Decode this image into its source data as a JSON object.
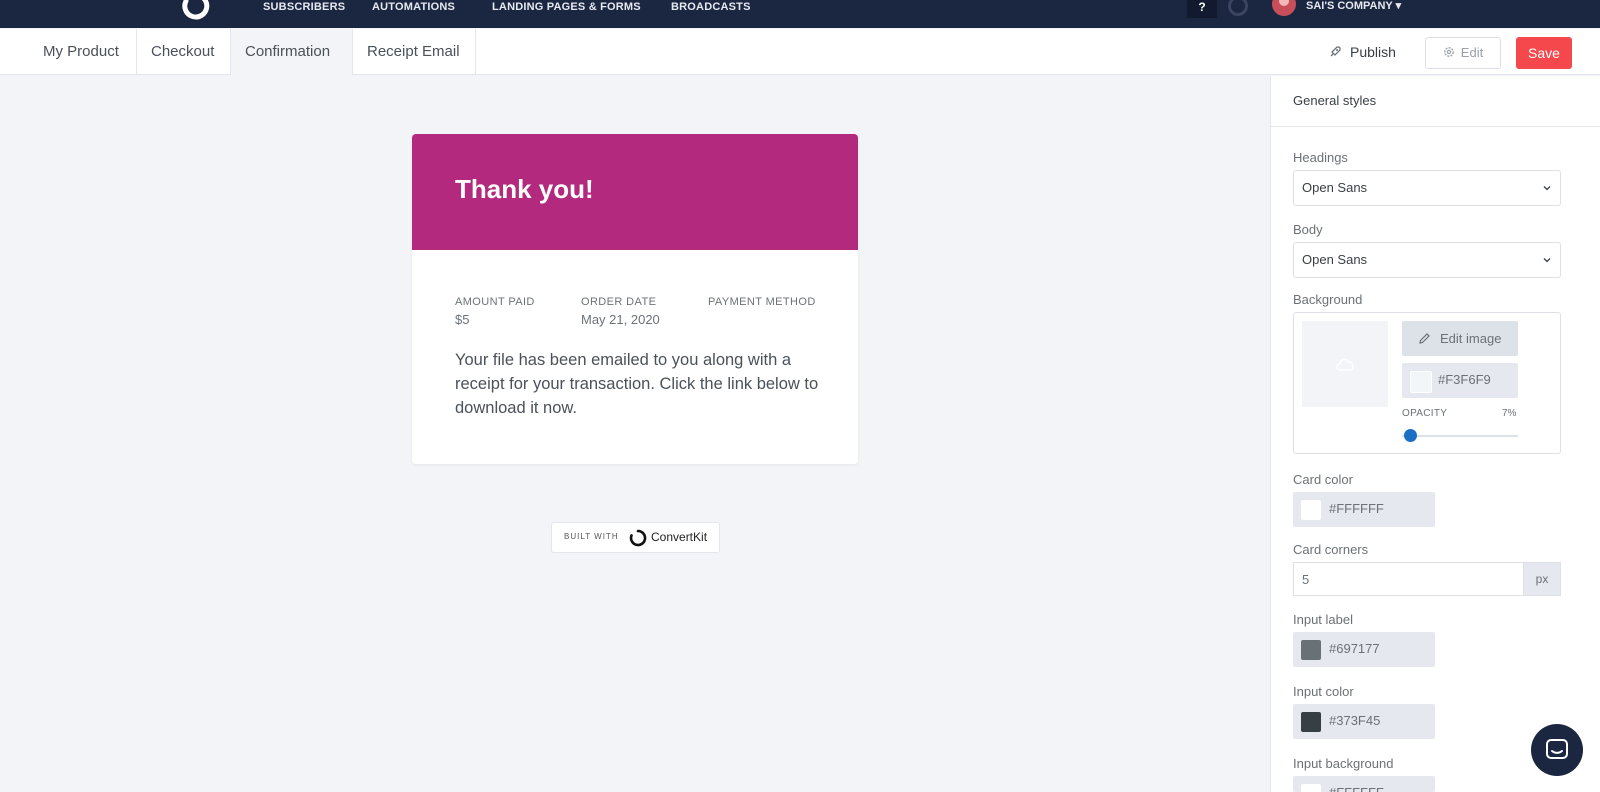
{
  "topnav": {
    "items": [
      "SUBSCRIBERS",
      "AUTOMATIONS",
      "LANDING PAGES & FORMS",
      "BROADCASTS"
    ],
    "help_label": "?",
    "company": "SAI'S COMPANY",
    "company_caret": "▾",
    "bg_color": "#1b2641"
  },
  "tabs": [
    {
      "label": "My Product",
      "active": false
    },
    {
      "label": "Checkout",
      "active": false
    },
    {
      "label": "Confirmation",
      "active": true
    },
    {
      "label": "Receipt Email",
      "active": false
    }
  ],
  "toolbar": {
    "publish_label": "Publish",
    "edit_label": "Edit",
    "save_label": "Save",
    "save_color": "#f5484d"
  },
  "card": {
    "title": "Thank you!",
    "header_color": "#b2297e",
    "meta": [
      {
        "label": "AMOUNT PAID",
        "value": "$5"
      },
      {
        "label": "ORDER DATE",
        "value": "May 21, 2020"
      },
      {
        "label": "PAYMENT METHOD",
        "value": ""
      }
    ],
    "body": "Your file has been emailed to you along with a receipt for your transaction. Click the link below to download it now."
  },
  "badge": {
    "small": "BUILT WITH",
    "name": "ConvertKit"
  },
  "panel": {
    "title": "General styles",
    "headings_label": "Headings",
    "headings_value": "Open Sans",
    "body_label": "Body",
    "body_value": "Open Sans",
    "background_label": "Background",
    "edit_image_label": "Edit image",
    "background_color": "#F3F6F9",
    "opacity_label": "OPACITY",
    "opacity_value": "7%",
    "opacity_fraction": 0.07,
    "card_color_label": "Card color",
    "card_color": "#FFFFFF",
    "card_corners_label": "Card corners",
    "card_corners_value": "5",
    "card_corners_unit": "px",
    "input_label_label": "Input label",
    "input_label_color": "#697177",
    "input_color_label": "Input color",
    "input_color": "#373F45",
    "input_background_label": "Input background",
    "input_background_color": "#FFFFFF"
  },
  "icons": [
    "convertkit-logo-icon",
    "rocket-icon",
    "gear-icon",
    "chevron-down-icon",
    "cloud-upload-icon",
    "pencil-icon",
    "chat-icon"
  ]
}
